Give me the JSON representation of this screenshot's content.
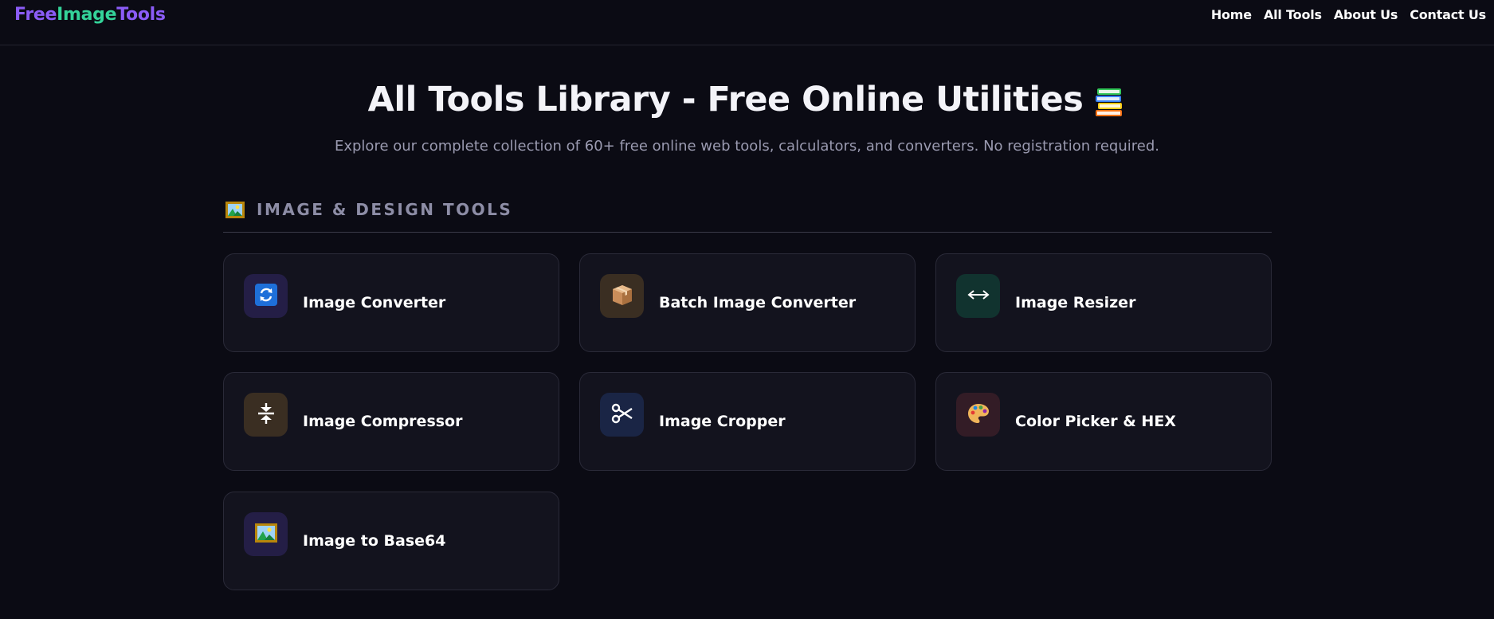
{
  "header": {
    "logo": {
      "part1": "Free",
      "part2": "Image",
      "part3": "Tools"
    },
    "nav": [
      {
        "label": "Home"
      },
      {
        "label": "All Tools"
      },
      {
        "label": "About Us"
      },
      {
        "label": "Contact Us"
      }
    ]
  },
  "hero": {
    "title": "All Tools Library - Free Online Utilities",
    "title_icon": "books-icon",
    "subtitle": "Explore our complete collection of 60+ free online web tools, calculators, and converters. No registration required."
  },
  "section": {
    "icon": "framed-picture-icon",
    "title": "IMAGE & DESIGN TOOLS"
  },
  "tools": [
    {
      "label": "Image Converter",
      "icon": "refresh-arrows-icon",
      "icon_bg": "#241e46"
    },
    {
      "label": "Batch Image Converter",
      "icon": "package-box-icon",
      "icon_bg": "#3a2e22"
    },
    {
      "label": "Image Resizer",
      "icon": "left-right-arrow-icon",
      "icon_bg": "#11332f"
    },
    {
      "label": "Image Compressor",
      "icon": "compress-arrows-icon",
      "icon_bg": "#3a2e22"
    },
    {
      "label": "Image Cropper",
      "icon": "scissors-icon",
      "icon_bg": "#1a2545"
    },
    {
      "label": "Color Picker & HEX",
      "icon": "palette-icon",
      "icon_bg": "#331c26"
    },
    {
      "label": "Image to Base64",
      "icon": "framed-picture-icon",
      "icon_bg": "#241e46"
    }
  ],
  "colors": {
    "background": "#0b0b14",
    "card_background": "#13131e",
    "logo_purple": "#8b5cf6",
    "logo_green": "#34d399",
    "subtitle": "#9a9ab0",
    "section_title": "#8d8da6"
  }
}
